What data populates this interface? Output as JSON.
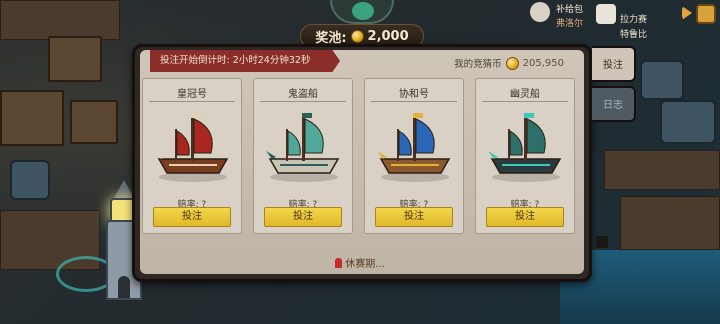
{
  "hud": {
    "pool_label": "奖池:",
    "pool_value": "2,000",
    "top_right_line1": "补给包",
    "top_right_line2": "弗洛尔",
    "event_line1": "拉力赛",
    "event_line2": "特鲁比"
  },
  "panel": {
    "countdown_text": "投注开始倒计时: 2小时24分钟32秒",
    "balance_label": "我的竞猜币",
    "balance_value": "205,950",
    "status_text": "休赛期..."
  },
  "tabs": [
    {
      "label": "投注"
    },
    {
      "label": "日志"
    }
  ],
  "ships": [
    {
      "name": "皇冠号",
      "odds": "赔率: ?",
      "button": "投注",
      "sail": "#a8281f",
      "hull": "#7a3e1e",
      "accent": "#e4d2b2"
    },
    {
      "name": "鬼盗船",
      "odds": "赔率: ?",
      "button": "投注",
      "sail": "#4fa89a",
      "hull": "#c8c5b5",
      "accent": "#2c5f5a"
    },
    {
      "name": "协和号",
      "odds": "赔率: ?",
      "button": "投注",
      "sail": "#2a66b8",
      "hull": "#8a5a2c",
      "accent": "#e3b13b"
    },
    {
      "name": "幽灵船",
      "odds": "赔率: ?",
      "button": "投注",
      "sail": "#2d6f6a",
      "hull": "#2b3a3c",
      "accent": "#3fc7b8"
    }
  ]
}
